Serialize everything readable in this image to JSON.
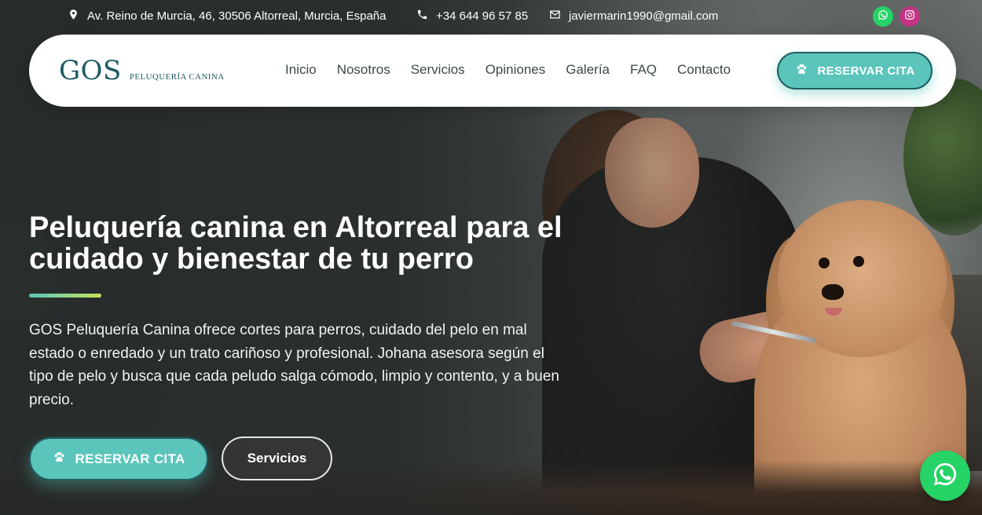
{
  "topbar": {
    "address": "Av. Reino de Murcia, 46, 30506 Altorreal, Murcia, España",
    "phone": "+34 644 96 57 85",
    "email": "javiermarin1990@gmail.com",
    "address_icon": "location-pin-icon",
    "phone_icon": "phone-icon",
    "email_icon": "email-icon",
    "social": [
      {
        "icon": "whatsapp-icon",
        "color": "#25d366"
      },
      {
        "icon": "instagram-icon",
        "color": "#c13584"
      }
    ]
  },
  "header": {
    "logo_main": "GOS",
    "logo_sub": "Peluquería Canina",
    "nav": [
      "Inicio",
      "Nosotros",
      "Servicios",
      "Opiniones",
      "Galería",
      "FAQ",
      "Contacto"
    ],
    "cta_label": "RESERVAR CITA",
    "cta_icon": "paw-icon"
  },
  "hero": {
    "title": "Peluquería canina en Altorreal para el cuidado y bienestar de tu perro",
    "description": "GOS Peluquería Canina ofrece cortes para perros, cuidado del pelo en mal estado o enredado y un trato cariñoso y profesional. Johana asesora según el tipo de pelo y busca que cada peludo salga cómodo, limpio y contento, y a buen precio.",
    "primary_button": "RESERVAR CITA",
    "secondary_button": "Servicios"
  },
  "colors": {
    "accent": "#5bc5bb",
    "accent_border": "#1f5e63",
    "brand_text": "#1e5a63",
    "whatsapp": "#25d366"
  },
  "floating": {
    "icon": "whatsapp-icon"
  }
}
